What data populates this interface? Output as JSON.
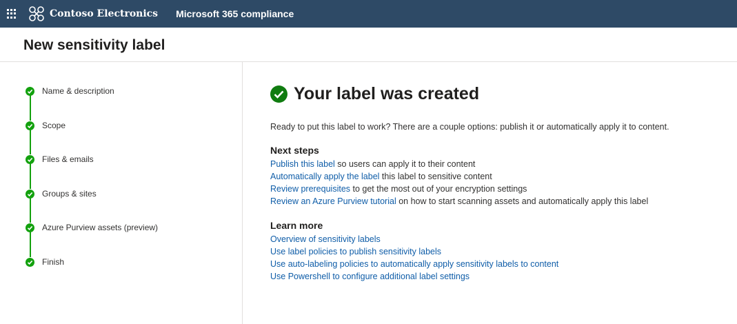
{
  "topbar": {
    "org_name": "Contoso Electronics",
    "app_name": "Microsoft 365 compliance",
    "bg_color": "#2e4a66"
  },
  "page": {
    "title": "New sensitivity label"
  },
  "steps": [
    {
      "label": "Name & description",
      "status": "complete"
    },
    {
      "label": "Scope",
      "status": "complete"
    },
    {
      "label": "Files & emails",
      "status": "complete"
    },
    {
      "label": "Groups & sites",
      "status": "complete"
    },
    {
      "label": "Azure Purview assets (preview)",
      "status": "complete"
    },
    {
      "label": "Finish",
      "status": "complete"
    }
  ],
  "main": {
    "title": "Your label was created",
    "intro": "Ready to put this label to work? There are a couple options: publish it or automatically apply it to content.",
    "next_steps": {
      "heading": "Next steps",
      "items": [
        {
          "link": "Publish this label",
          "text": " so users can apply it to their content"
        },
        {
          "link": "Automatically apply the label",
          "text": " this label to sensitive content"
        },
        {
          "link": "Review prerequisites",
          "text": " to get the most out of your encryption settings"
        },
        {
          "link": "Review an Azure Purview tutorial",
          "text": " on how to start scanning assets and automatically apply this label"
        }
      ]
    },
    "learn_more": {
      "heading": "Learn more",
      "items": [
        {
          "link": "Overview of sensitivity labels"
        },
        {
          "link": "Use label policies to publish sensitivity labels"
        },
        {
          "link": "Use auto-labeling policies to automatically apply sensitivity labels to content"
        },
        {
          "link": "Use Powershell to configure additional label settings"
        }
      ]
    }
  },
  "colors": {
    "success": "#13a10e",
    "link": "#0f5da8"
  },
  "icons": {
    "app_launcher": "waffle-icon",
    "org_logo": "contoso-logo-icon",
    "step_status": "checkmark-circle-icon",
    "success": "checkmark-circle-icon"
  }
}
